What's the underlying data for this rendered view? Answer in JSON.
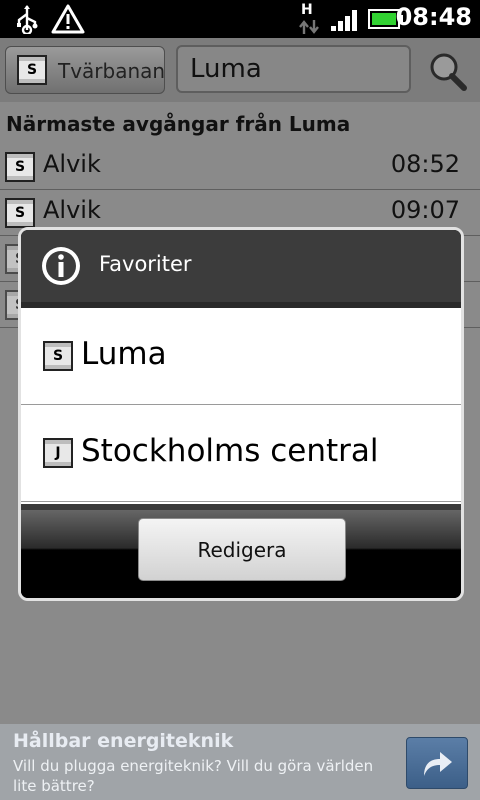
{
  "status_bar": {
    "time": "08:48",
    "network_type": "H",
    "icons": [
      "usb-icon",
      "warning-icon",
      "data-transfer-icon",
      "signal-icon",
      "battery-icon"
    ]
  },
  "toolbar": {
    "line_button": {
      "icon_letter": "S",
      "label": "Tvärbanan"
    },
    "search": {
      "value": "Luma"
    },
    "search_icon": "search-icon"
  },
  "departures": {
    "title": "Närmaste avgångar från Luma",
    "items": [
      {
        "icon_letter": "S",
        "destination": "Alvik",
        "time": "08:52"
      },
      {
        "icon_letter": "S",
        "destination": "Alvik",
        "time": "09:07"
      }
    ],
    "hidden_rows_badges": [
      "S",
      "S"
    ]
  },
  "dialog": {
    "icon": "info-icon",
    "title": "Favoriter",
    "items": [
      {
        "icon_letter": "S",
        "label": "Luma"
      },
      {
        "icon_letter": "J",
        "label": "Stockholms central"
      }
    ],
    "button_label": "Redigera"
  },
  "ad": {
    "title": "Hållbar energiteknik",
    "text": "Vill du plugga energiteknik? Vill du göra världen lite bättre?",
    "button_icon": "share-arrow-icon"
  },
  "colors": {
    "dialog_header": "#3c3c3c",
    "list_background": "#8a8a8a",
    "ad_button": "#4a6f99"
  }
}
